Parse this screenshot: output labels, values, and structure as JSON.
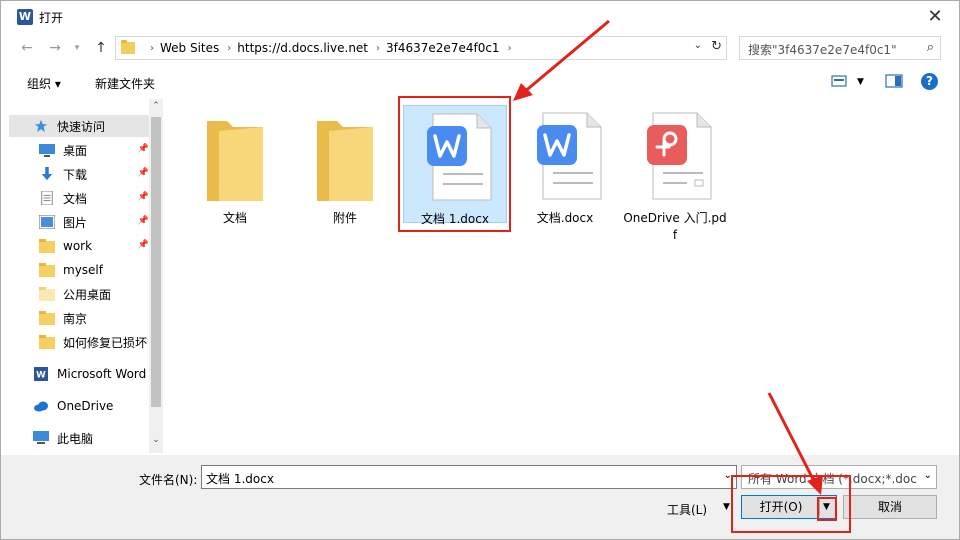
{
  "window": {
    "title": "打开",
    "app_icon_letter": "W"
  },
  "address": {
    "crumbs": [
      "Web Sites",
      "https://d.docs.live.net",
      "3f4637e2e7e4f0c1"
    ]
  },
  "search": {
    "placeholder": "搜索\"3f4637e2e7e4f0c1\""
  },
  "toolbar": {
    "organize": "组织 ▾",
    "new_folder": "新建文件夹"
  },
  "sidebar": {
    "items": [
      {
        "label": "快速访问",
        "icon": "star-icon"
      },
      {
        "label": "桌面",
        "icon": "desktop-icon",
        "pinned": true
      },
      {
        "label": "下载",
        "icon": "download-icon",
        "pinned": true
      },
      {
        "label": "文档",
        "icon": "documents-icon",
        "pinned": true
      },
      {
        "label": "图片",
        "icon": "pictures-icon",
        "pinned": true
      },
      {
        "label": "work",
        "icon": "folder-icon",
        "pinned": true
      },
      {
        "label": "myself",
        "icon": "folder-icon"
      },
      {
        "label": "公用桌面",
        "icon": "folder-icon"
      },
      {
        "label": "南京",
        "icon": "folder-icon"
      },
      {
        "label": "如何修复已损坏",
        "icon": "folder-icon"
      },
      {
        "label": "Microsoft Word",
        "icon": "word-icon"
      },
      {
        "label": "OneDrive",
        "icon": "cloud-icon"
      },
      {
        "label": "此电脑",
        "icon": "computer-icon"
      }
    ]
  },
  "files": [
    {
      "name": "文档",
      "type": "folder"
    },
    {
      "name": "附件",
      "type": "folder"
    },
    {
      "name": "文档 1.docx",
      "type": "word",
      "selected": true
    },
    {
      "name": "文档.docx",
      "type": "word"
    },
    {
      "name": "OneDrive 入门.pdf",
      "type": "pdf"
    }
  ],
  "bottom": {
    "filename_label": "文件名(N):",
    "filename_value": "文档 1.docx",
    "filetype_value": "所有 Word 文档 (*.docx;*.docm;*.doc",
    "tools_label": "工具(L)",
    "open_label": "打开(O)",
    "cancel_label": "取消"
  },
  "colors": {
    "accent": "#0078d7",
    "annotation": "#e3221c",
    "word_blue": "#4a8bef",
    "pdf_red": "#e95c5c"
  }
}
